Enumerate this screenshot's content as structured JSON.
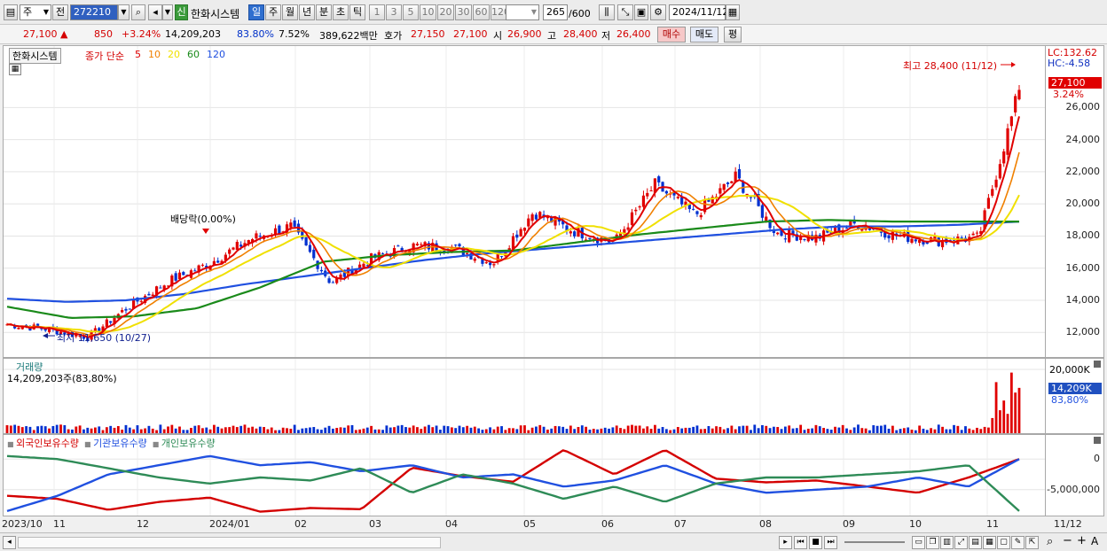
{
  "toolbar": {
    "period_select": "주",
    "prev_label": "전",
    "stock_code": "272210",
    "credit_badge": "신",
    "stock_name": "한화시스템",
    "period_tabs": [
      "일",
      "주",
      "월",
      "년",
      "분",
      "초",
      "틱"
    ],
    "selected_period": "일",
    "interval_buttons": [
      "1",
      "3",
      "5",
      "10",
      "20",
      "30",
      "60",
      "120"
    ],
    "count_value": "265",
    "count_total": "/600",
    "date_value": "2024/11/12"
  },
  "quote": {
    "price": "27,100",
    "change": "850",
    "change_pct": "+3.24%",
    "volume": "14,209,203",
    "volume_pct": "83.80%",
    "turnover": "7.52%",
    "amount": "389,622백만",
    "bid_label": "호가",
    "ask": "27,150",
    "bid": "27,100",
    "open_label": "시",
    "open": "26,900",
    "high_label": "고",
    "high": "28,400",
    "low_label": "저",
    "low": "26,400",
    "buy_button": "매수",
    "sell_button": "매도",
    "eval_button": "평"
  },
  "price_panel": {
    "name_tag": "한화시스템",
    "ma_label": "종가 단순",
    "ma_periods": [
      {
        "label": "5",
        "color": "#e00000"
      },
      {
        "label": "10",
        "color": "#f08000"
      },
      {
        "label": "20",
        "color": "#f0e000"
      },
      {
        "label": "60",
        "color": "#1a8a1a"
      },
      {
        "label": "120",
        "color": "#2050e0"
      }
    ],
    "high_annotation": "최고 28,400 (11/12)",
    "low_annotation": "최저 11,650 (10/27)",
    "dividend_annotation": "배당락(0.00%)",
    "lc_label": "LC:132.62",
    "hc_label": "HC:-4.58",
    "price_box": "27,100",
    "price_box_pct": "3.24%",
    "yticks": [
      "26,000",
      "24,000",
      "22,000",
      "20,000",
      "18,000",
      "16,000",
      "14,000",
      "12,000"
    ]
  },
  "volume_panel": {
    "title": "거래량",
    "summary": "14,209,203주(83,80%)",
    "ytick": "20,000K",
    "value_box": "14,209K",
    "value_pct": "83,80%"
  },
  "investor_panel": {
    "legend": [
      {
        "label": "외국인보유수량",
        "color": "#d40000"
      },
      {
        "label": "기관보유수량",
        "color": "#2050e0"
      },
      {
        "label": "개인보유수량",
        "color": "#2e8b57"
      }
    ],
    "yticks": [
      "0",
      "-5,000,000"
    ]
  },
  "x_labels": [
    "2023/10",
    "11",
    "12",
    "2024/01",
    "02",
    "03",
    "04",
    "05",
    "06",
    "07",
    "08",
    "09",
    "10",
    "11",
    "11/12"
  ],
  "chart_data": [
    {
      "type": "candlestick",
      "title": "한화시스템",
      "ylim": [
        10800,
        29000
      ],
      "x": [
        "2023/10",
        "11",
        "12",
        "2024/01",
        "02",
        "03",
        "04",
        "05",
        "06",
        "07",
        "08",
        "09",
        "10",
        "11"
      ],
      "close_path": [
        12500,
        12200,
        11700,
        13600,
        15200,
        16300,
        17800,
        18600,
        15100,
        16600,
        17400,
        17300,
        16300,
        19500,
        18300,
        17600,
        21200,
        19300,
        21700,
        18200,
        17900,
        18800,
        18000,
        17700,
        17900,
        27100
      ],
      "ma120_path": [
        14100,
        13900,
        14000,
        14400,
        15000,
        15500,
        16000,
        16500,
        16900,
        17200,
        17500,
        17800,
        18100,
        18400,
        18600,
        18600,
        18700,
        18900
      ],
      "ma60_path": [
        13600,
        12900,
        13000,
        13500,
        14800,
        16400,
        16800,
        17000,
        17100,
        17600,
        18100,
        18500,
        18900,
        19000,
        18900,
        18900,
        18900
      ]
    },
    {
      "type": "bar",
      "title": "거래량",
      "ylim": [
        0,
        20000
      ],
      "ylabel": "K",
      "last_value": 14209
    },
    {
      "type": "line",
      "series": [
        {
          "name": "외국인보유수량",
          "values": [
            -6000000,
            -6500000,
            -8300000,
            -7000000,
            -6300000,
            -8600000,
            -8000000,
            -8200000,
            -1400000,
            -2800000,
            -3700000,
            1500000,
            -2500000,
            1500000,
            -3200000,
            -3800000,
            -3500000,
            -4500000,
            -5500000,
            -3000000,
            0
          ]
        },
        {
          "name": "기관보유수량",
          "values": [
            -8500000,
            -6000000,
            -2500000,
            -1000000,
            500000,
            -1000000,
            -500000,
            -2000000,
            -1000000,
            -3000000,
            -2500000,
            -4500000,
            -3500000,
            -1000000,
            -4000000,
            -5500000,
            -5000000,
            -4500000,
            -3000000,
            -4500000,
            0
          ]
        },
        {
          "name": "개인보유수량",
          "values": [
            500000,
            0,
            -1500000,
            -3000000,
            -4000000,
            -3000000,
            -3500000,
            -1500000,
            -5500000,
            -2500000,
            -4000000,
            -6500000,
            -4500000,
            -7000000,
            -4000000,
            -3000000,
            -3000000,
            -2500000,
            -2000000,
            -1000000,
            -8500000
          ]
        }
      ],
      "ylim": [
        -8800000,
        2500000
      ]
    }
  ]
}
